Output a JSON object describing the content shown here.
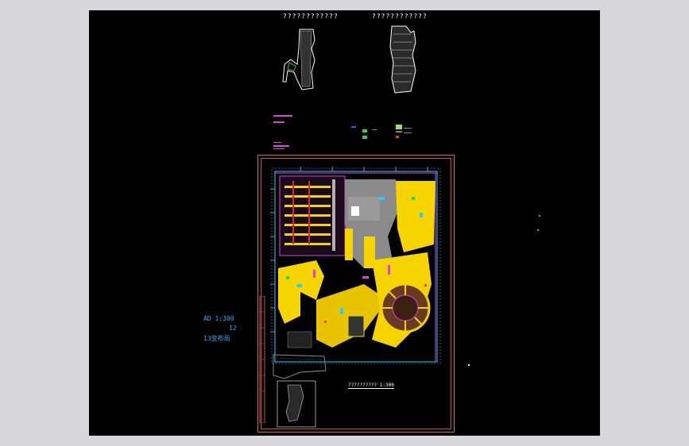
{
  "drawing": {
    "elevation_title_left": "????????????",
    "elevation_title_right": "????????????",
    "plan_title": "??????????",
    "scale_label": "1:300",
    "annotation_line1": "AD 1:300",
    "annotation_line2": "12",
    "annotation_line3": "13变布局",
    "colors": {
      "background": "#000000",
      "frame": "#d9655a",
      "annotation": "#2fa8ff",
      "plan_fill": "#f5d400",
      "plan_gray": "#8a8a8a",
      "plan_magenta": "#e040e0",
      "plan_cyan": "#20d0ff"
    }
  }
}
